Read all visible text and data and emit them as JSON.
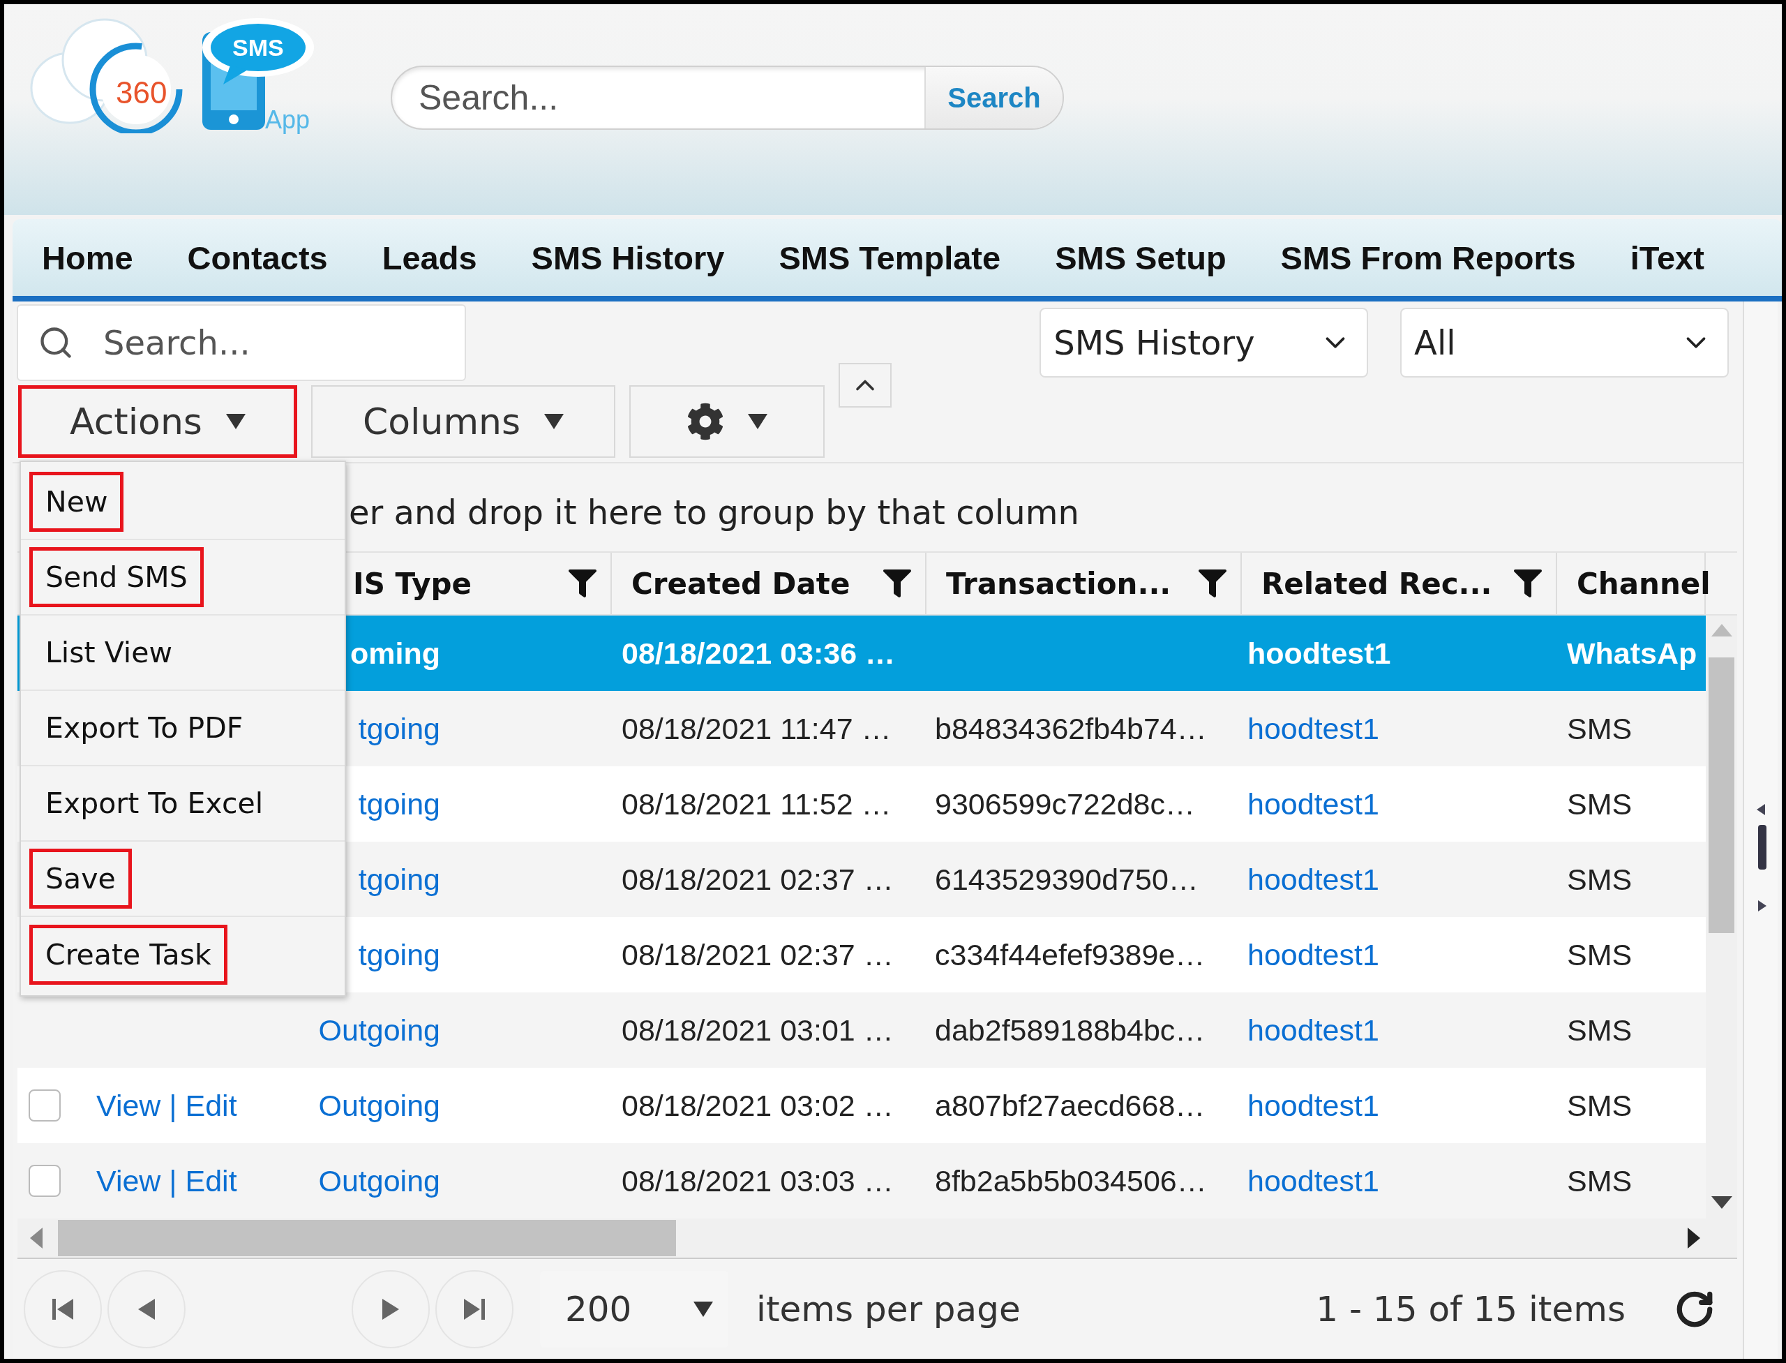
{
  "logo": {
    "number": "360",
    "badge": "SMS",
    "suffix": "App"
  },
  "header_search": {
    "placeholder": "Search...",
    "button": "Search"
  },
  "nav_tabs": [
    "Home",
    "Contacts",
    "Leads",
    "SMS History",
    "SMS Template",
    "SMS Setup",
    "SMS From Reports",
    "iText"
  ],
  "grid_search": {
    "placeholder": "Search..."
  },
  "object_select": {
    "value": "SMS History"
  },
  "filter_select": {
    "value": "All"
  },
  "toolbar": {
    "actions": {
      "label": "Actions",
      "highlighted": true
    },
    "columns": "Columns"
  },
  "actions_menu": [
    {
      "label": "New",
      "highlighted": true
    },
    {
      "label": "Send SMS",
      "highlighted": true
    },
    {
      "label": "List View",
      "highlighted": false
    },
    {
      "label": "Export To PDF",
      "highlighted": false
    },
    {
      "label": "Export To Excel",
      "highlighted": false
    },
    {
      "label": "Save",
      "highlighted": true
    },
    {
      "label": "Create Task",
      "highlighted": true
    }
  ],
  "group_hint": "er and drop it here to group by that column",
  "columns": [
    {
      "label": "IS Type",
      "filter": true
    },
    {
      "label": "Created Date",
      "filter": true
    },
    {
      "label": "Transaction...",
      "filter": true
    },
    {
      "label": "Related Rec...",
      "filter": true
    },
    {
      "label": "Channel",
      "filter": false
    }
  ],
  "rows": [
    {
      "selected": true,
      "type": "oming",
      "created": "08/18/2021 03:36 …",
      "related": "hoodtest1",
      "channel": "WhatsAp"
    },
    {
      "selected": false,
      "type": "tgoing",
      "created": "08/18/2021 11:47 …",
      "transaction": "b84834362fb4b74…",
      "related": "hoodtest1",
      "channel": "SMS"
    },
    {
      "selected": false,
      "type": "tgoing",
      "created": "08/18/2021 11:52 …",
      "transaction": "9306599c722d8c…",
      "related": "hoodtest1",
      "channel": "SMS"
    },
    {
      "selected": false,
      "type": "tgoing",
      "created": "08/18/2021 02:37 …",
      "transaction": "6143529390d750…",
      "related": "hoodtest1",
      "channel": "SMS"
    },
    {
      "selected": false,
      "type": "tgoing",
      "created": "08/18/2021 02:37 …",
      "transaction": "c334f44efef9389e…",
      "related": "hoodtest1",
      "channel": "SMS"
    },
    {
      "selected": false,
      "type": "Outgoing",
      "created": "08/18/2021 03:01 …",
      "transaction": "dab2f589188b4bc…",
      "related": "hoodtest1",
      "channel": "SMS"
    },
    {
      "selected": false,
      "checked": false,
      "actions": "View | Edit",
      "type": "Outgoing",
      "created": "08/18/2021 03:02 …",
      "transaction": "a807bf27aecd668…",
      "related": "hoodtest1",
      "channel": "SMS"
    },
    {
      "selected": false,
      "checked": false,
      "actions": "View | Edit",
      "type": "Outgoing",
      "created": "08/18/2021 03:03 …",
      "transaction": "8fb2a5b5b034506…",
      "related": "hoodtest1",
      "channel": "SMS"
    }
  ],
  "pager": {
    "page_size": "200",
    "label": "items per page",
    "summary": "1 - 15 of 15 items"
  }
}
